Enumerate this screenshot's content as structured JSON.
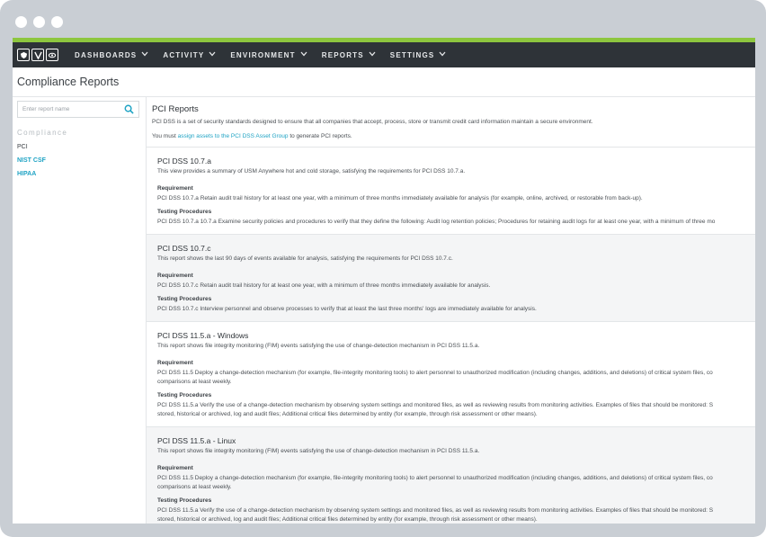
{
  "nav": {
    "items": [
      {
        "label": "DASHBOARDS"
      },
      {
        "label": "ACTIVITY"
      },
      {
        "label": "ENVIRONMENT"
      },
      {
        "label": "REPORTS"
      },
      {
        "label": "SETTINGS"
      }
    ]
  },
  "page": {
    "title": "Compliance Reports"
  },
  "sidebar": {
    "search_placeholder": "Enter report name",
    "heading": "Compliance",
    "items": [
      {
        "label": "PCI"
      },
      {
        "label": "NIST CSF"
      },
      {
        "label": "HIPAA"
      }
    ]
  },
  "intro": {
    "title": "PCI Reports",
    "description": "PCI DSS is a set of security standards designed to ensure that all companies that accept, process, store or transmit credit card information maintain a secure environment.",
    "must_prefix": "You must ",
    "must_link": "assign assets to the PCI DSS Asset Group",
    "must_suffix": " to generate PCI reports."
  },
  "reports": [
    {
      "title": "PCI DSS 10.7.a",
      "description": "This view provides a summary of USM Anywhere hot and cold storage, satisfying the requirements for PCI DSS 10.7.a.",
      "requirement_label": "Requirement",
      "requirement": "PCI DSS 10.7.a Retain audit trail history for at least one year, with a minimum of three months immediately available for analysis (for example, online, archived, or restorable from back-up).",
      "testing_label": "Testing Procedures",
      "testing_1": "PCI DSS 10.7.a 10.7.a Examine security policies and procedures to verify that they define the following: Audit log retention policies; Procedures for retaining audit logs for at least one year, with a minimum of three mo",
      "testing_2": ""
    },
    {
      "title": "PCI DSS 10.7.c",
      "description": "This report shows the last 90 days of events available for analysis, satisfying the requirements for PCI DSS 10.7.c.",
      "requirement_label": "Requirement",
      "requirement": "PCI DSS 10.7.c Retain audit trail history for at least one year, with a minimum of three months immediately available for analysis.",
      "testing_label": "Testing Procedures",
      "testing_1": "PCI DSS 10.7.c Interview personnel and observe processes to verify that at least the last three months' logs are immediately available for analysis.",
      "testing_2": ""
    },
    {
      "title": "PCI DSS 11.5.a - Windows",
      "description": "This report shows file integrity monitoring (FIM) events satisfying the use of change-detection mechanism in PCI DSS 11.5.a.",
      "requirement_label": "Requirement",
      "requirement": "PCI DSS 11.5 Deploy a change-detection mechanism (for example, file-integrity monitoring tools) to alert personnel to unauthorized modification (including changes, additions, and deletions) of critical system files, co",
      "requirement_2": "comparisons at least weekly.",
      "testing_label": "Testing Procedures",
      "testing_1": "PCI DSS 11.5.a Verify the use of a change-detection mechanism by observing system settings and monitored files, as well as reviewing results from monitoring activities. Examples of files that should be monitored: S",
      "testing_2": "stored, historical or archived, log and audit files; Additional critical files determined by entity (for example, through risk assessment or other means)."
    },
    {
      "title": "PCI DSS 11.5.a - Linux",
      "description": "This report shows file integrity monitoring (FIM) events satisfying the use of change-detection mechanism in PCI DSS 11.5.a.",
      "requirement_label": "Requirement",
      "requirement": "PCI DSS 11.5 Deploy a change-detection mechanism (for example, file-integrity monitoring tools) to alert personnel to unauthorized modification (including changes, additions, and deletions) of critical system files, co",
      "requirement_2": "comparisons at least weekly.",
      "testing_label": "Testing Procedures",
      "testing_1": "PCI DSS 11.5.a Verify the use of a change-detection mechanism by observing system settings and monitored files, as well as reviewing results from monitoring activities. Examples of files that should be monitored: S",
      "testing_2": "stored, historical or archived, log and audit files; Additional critical files determined by entity (for example, through risk assessment or other means)."
    }
  ],
  "colors": {
    "accent": "#8dc63f",
    "navbar": "#2e3338",
    "link": "#1fa3c4"
  }
}
